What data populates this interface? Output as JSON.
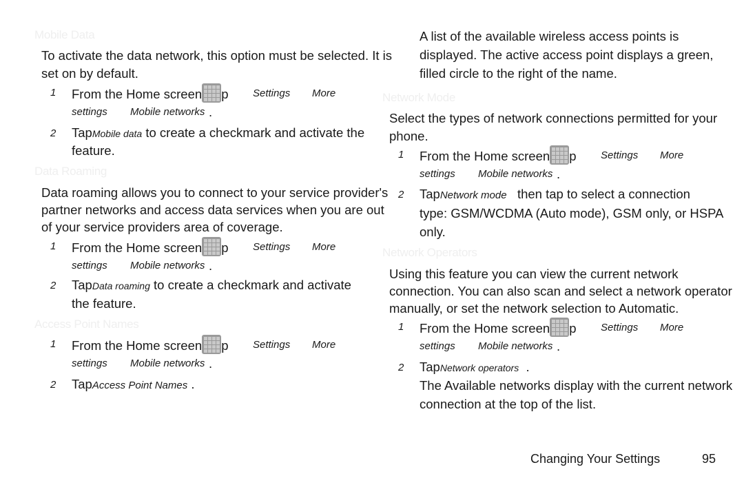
{
  "left": {
    "mobile_data": {
      "heading": "Mobile Data",
      "para1": "To activate the data network, this option must be selected. It is",
      "para2": "set on by default.",
      "step1": {
        "num": "1",
        "text": "From the Home screen",
        "p": "p",
        "settings": "Settings",
        "more": "More",
        "line2a": "settings",
        "line2b": "Mobile networks",
        "dot": "."
      },
      "step2": {
        "num": "2",
        "tap": "Tap",
        "item": "Mobile data",
        "text": "to create a checkmark and activate the",
        "line2": "feature."
      }
    },
    "data_roaming": {
      "heading": "Data Roaming",
      "para1": "Data roaming allows you to connect to your service provider's",
      "para2": "partner networks and access data services when you are out",
      "para3": "of your service providers area of coverage.",
      "step1": {
        "num": "1",
        "text": "From the Home screen",
        "p": "p",
        "settings": "Settings",
        "more": "More",
        "line2a": "settings",
        "line2b": "Mobile networks",
        "dot": "."
      },
      "step2": {
        "num": "2",
        "tap": "Tap",
        "item": "Data roaming",
        "text": "to create a checkmark and activate",
        "line2": "the feature."
      }
    },
    "apn": {
      "heading": "Access Point Names",
      "step1": {
        "num": "1",
        "text": "From the Home screen",
        "p": "p",
        "settings": "Settings",
        "more": "More",
        "line2a": "settings",
        "line2b": "Mobile networks",
        "dot": "."
      },
      "step2": {
        "num": "2",
        "tap": "Tap",
        "item": "Access Point Names",
        "dot": "."
      }
    }
  },
  "right": {
    "apn_cont": {
      "line1": "A list of the available wireless access points is",
      "line2": "displayed. The active access point displays a green,",
      "line3": "filled circle to the right of the name."
    },
    "network_mode": {
      "heading": "Network Mode",
      "para1": "Select the types of network connections permitted for your",
      "para2": "phone.",
      "step1": {
        "num": "1",
        "text": "From the Home screen",
        "p": "p",
        "settings": "Settings",
        "more": "More",
        "line2a": "settings",
        "line2b": "Mobile networks",
        "dot": "."
      },
      "step2": {
        "num": "2",
        "tap": "Tap",
        "item": "Network mode",
        "text": "then tap to select a connection",
        "line2": "type: GSM/WCDMA (Auto mode), GSM only, or HSPA",
        "line3": "only."
      }
    },
    "network_operators": {
      "heading": "Network Operators",
      "para1": "Using this feature you can view the current network",
      "para2": "connection. You can also scan and select a network operator",
      "para3": "manually, or set the network selection to Automatic.",
      "step1": {
        "num": "1",
        "text": "From the Home screen",
        "p": "p",
        "settings": "Settings",
        "more": "More",
        "line2a": "settings",
        "line2b": "Mobile networks",
        "dot": "."
      },
      "step2": {
        "num": "2",
        "tap": "Tap",
        "item": "Network operators",
        "dot": "."
      },
      "result1": "The Available networks display with the current network",
      "result2": "connection at the top of the list."
    }
  },
  "footer": {
    "section": "Changing Your Settings",
    "page": "95"
  },
  "icons": {
    "apps": "apps-grid-icon"
  }
}
